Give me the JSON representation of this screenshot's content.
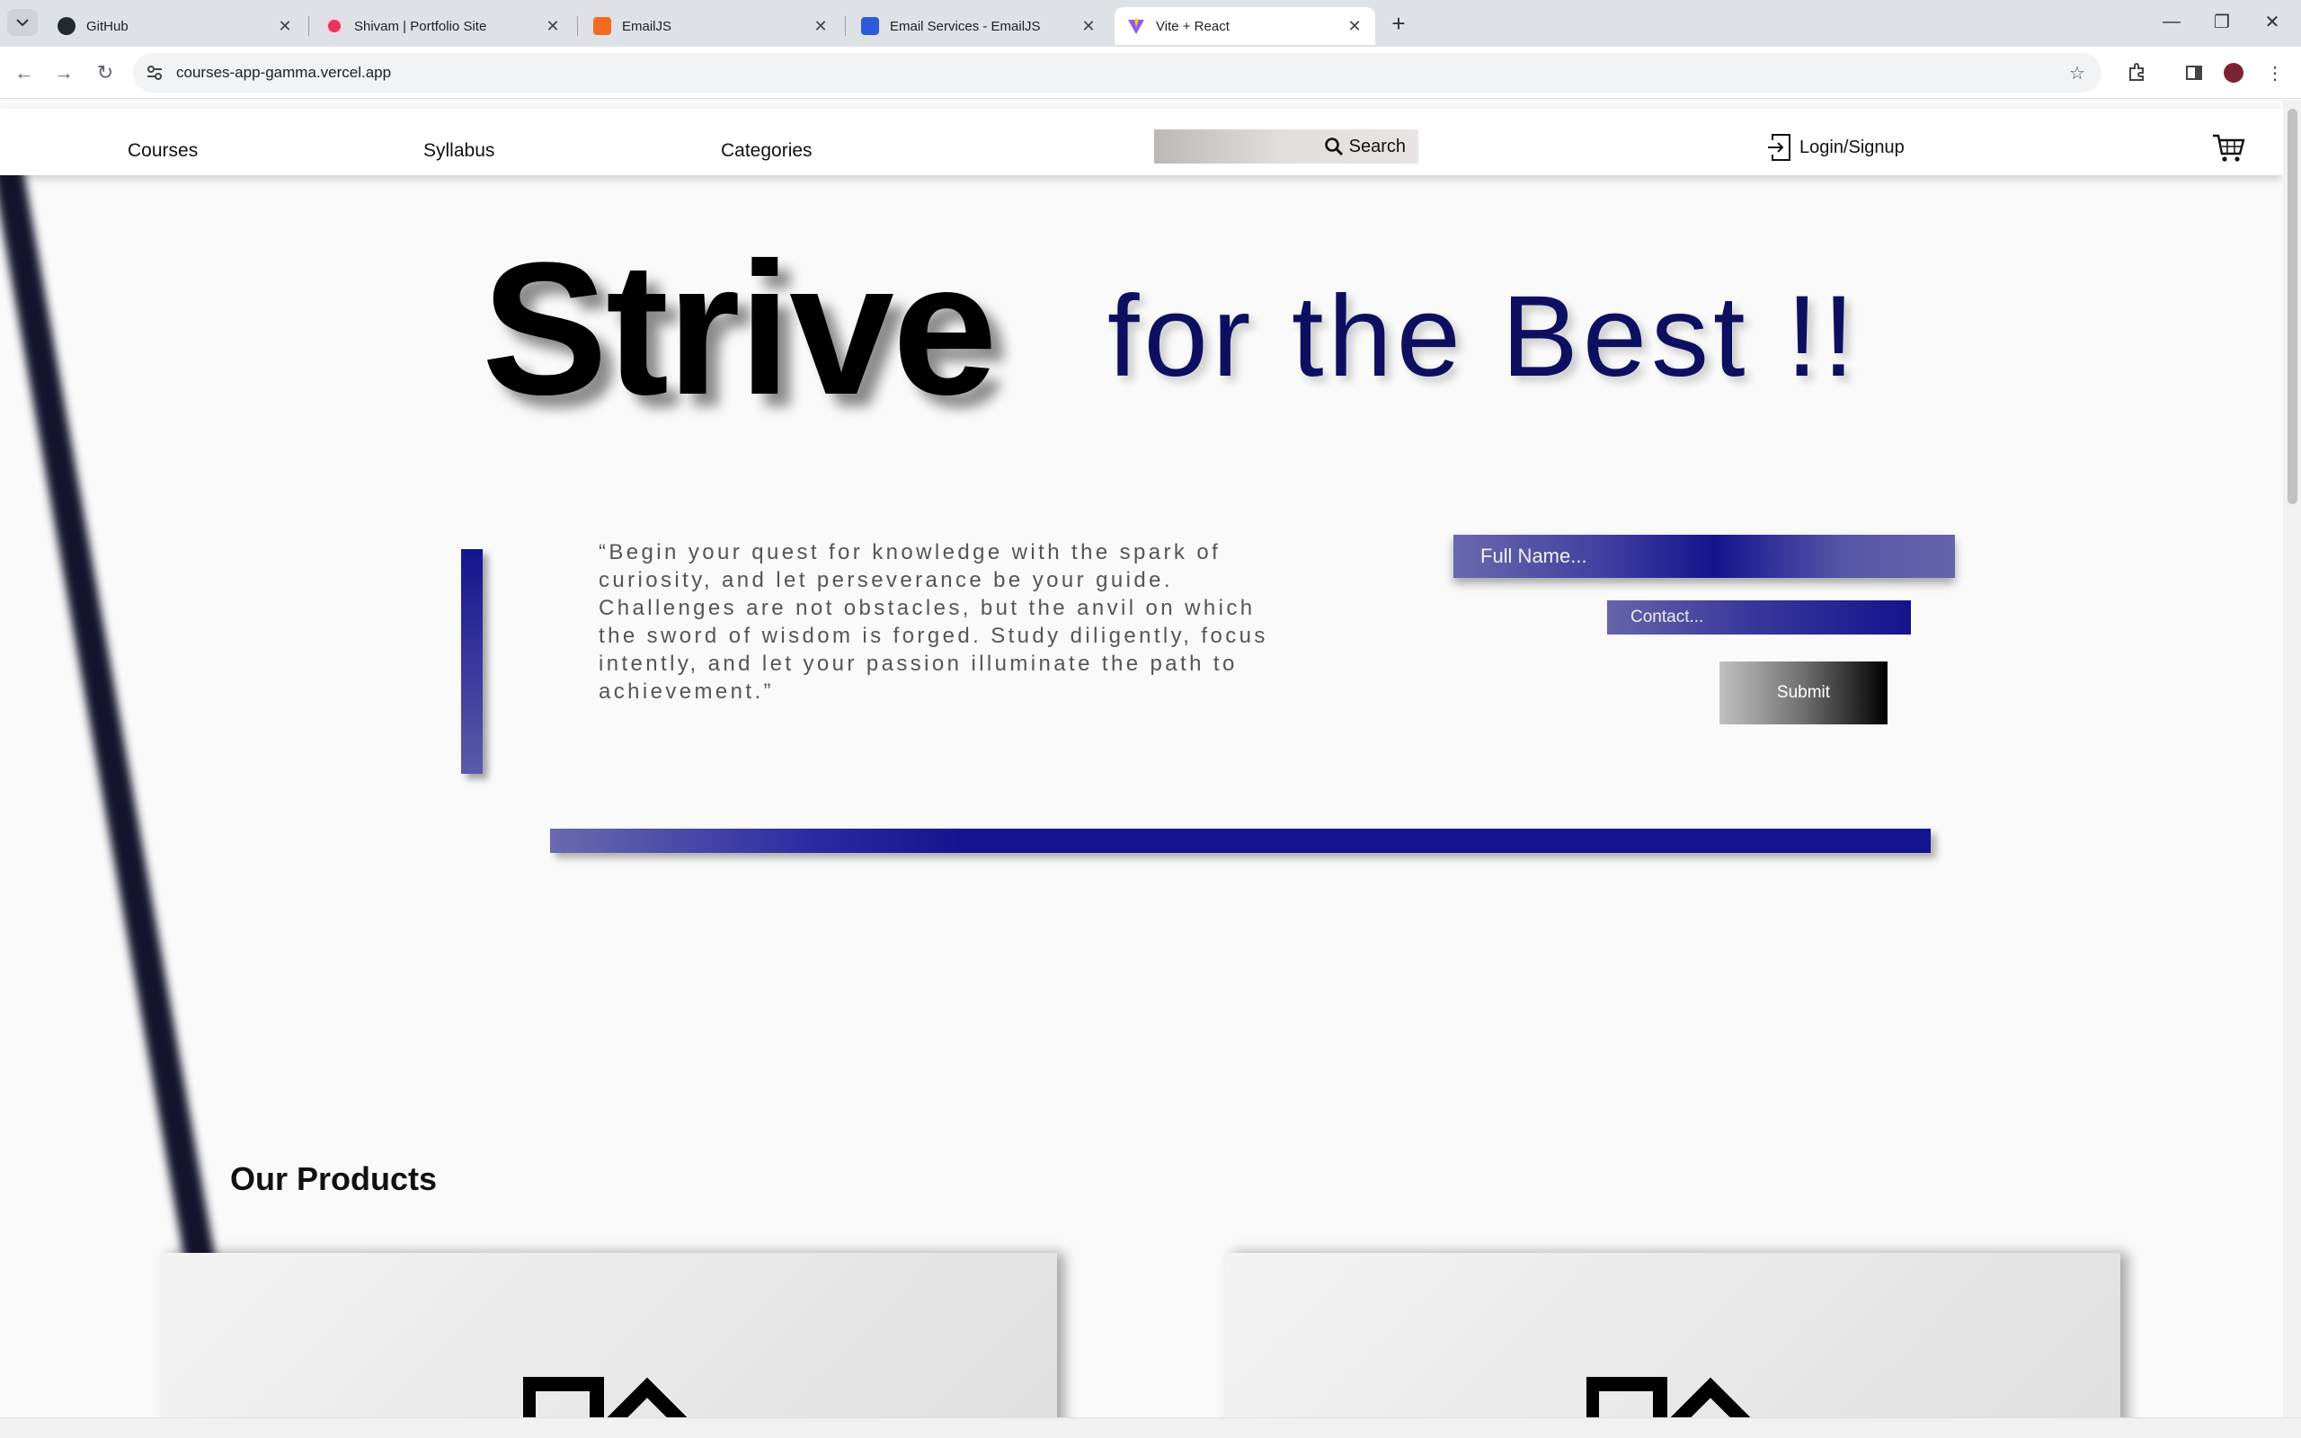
{
  "browser": {
    "tabs": [
      {
        "title": "GitHub",
        "icon": "github-icon"
      },
      {
        "title": "Shivam | Portfolio Site",
        "icon": "portfolio-icon"
      },
      {
        "title": "EmailJS",
        "icon": "emailjs-icon"
      },
      {
        "title": "Email Services - EmailJS",
        "icon": "emailjs-services-icon"
      },
      {
        "title": "Vite + React",
        "icon": "vite-icon",
        "active": true
      }
    ],
    "url": "courses-app-gamma.vercel.app"
  },
  "navbar": {
    "links": [
      "Courses",
      "Syllabus",
      "Categories"
    ],
    "search_label": "Search",
    "login_label": "Login/Signup"
  },
  "hero": {
    "strive": "Strive",
    "best": "for the Best !!"
  },
  "quote": "“Begin your quest for knowledge with the spark of curiosity, and let perseverance be your guide. Challenges are not obstacles, but the anvil on which the sword of wisdom is forged. Study diligently, focus intently, and let your passion illuminate the path to achievement.”",
  "form": {
    "name_placeholder": "Full Name...",
    "contact_placeholder": "Contact...",
    "submit_label": "Submit"
  },
  "products": {
    "title": "Our Products"
  },
  "colors": {
    "accent_navy": "#14148e",
    "heading_navy": "#0d1060"
  }
}
